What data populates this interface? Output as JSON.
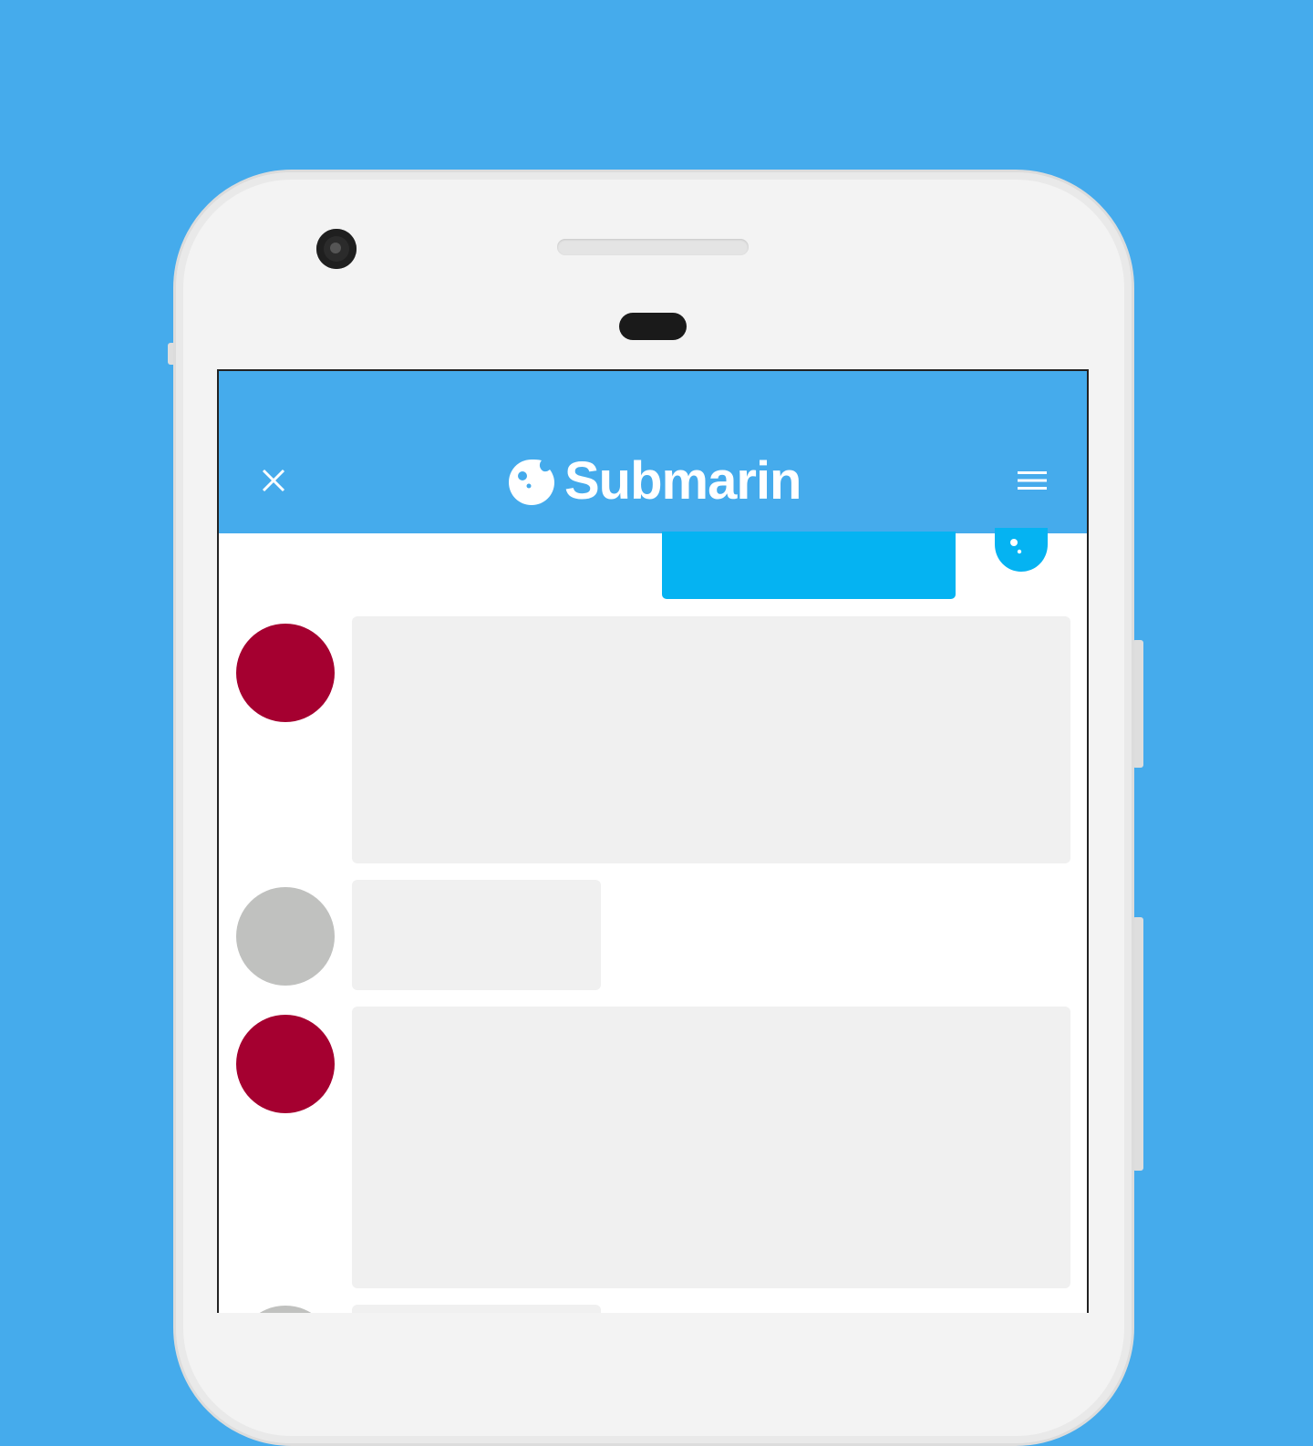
{
  "app": {
    "brand_name": "Submarin"
  },
  "colors": {
    "background": "#45abec",
    "appbar": "#45abec",
    "outgoing_bubble": "#05b3f2",
    "incoming_bubble": "#f0f0f0",
    "avatar_red": "#a50030",
    "avatar_gray": "#c0c1bf"
  },
  "appbar": {
    "close_icon": "close-icon",
    "menu_icon": "hamburger-menu-icon",
    "logo_icon": "submarin-logo-icon"
  },
  "messages": [
    {
      "direction": "outgoing",
      "avatar": "self"
    },
    {
      "direction": "incoming",
      "avatar_color": "red"
    },
    {
      "direction": "incoming",
      "avatar_color": "gray"
    },
    {
      "direction": "incoming",
      "avatar_color": "red"
    },
    {
      "direction": "incoming",
      "avatar_color": "gray"
    }
  ]
}
